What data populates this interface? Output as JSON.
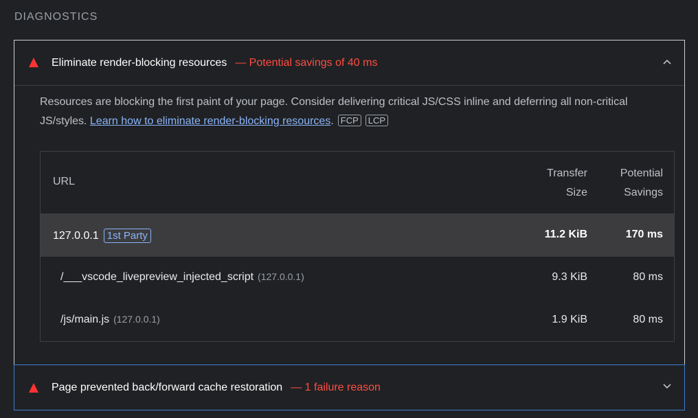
{
  "section_title": "DIAGNOSTICS",
  "audits": [
    {
      "title": "Eliminate render-blocking resources",
      "savings": "— Potential savings of 40 ms",
      "expanded": true,
      "description_text": "Resources are blocking the first paint of your page. Consider delivering critical JS/CSS inline and deferring all non-critical JS/styles. ",
      "link_text": "Learn how to eliminate render-blocking resources",
      "after_link": ".",
      "tags": [
        "FCP",
        "LCP"
      ],
      "table": {
        "headers": {
          "url": "URL",
          "transfer_line1": "Transfer",
          "transfer_line2": "Size",
          "savings_line1": "Potential",
          "savings_line2": "Savings"
        },
        "group": {
          "url": "127.0.0.1",
          "badge": "1st Party",
          "size": "11.2 KiB",
          "savings": "170 ms"
        },
        "rows": [
          {
            "url": "/___vscode_livepreview_injected_script",
            "origin": "(127.0.0.1)",
            "size": "9.3 KiB",
            "savings": "80 ms"
          },
          {
            "url": "/js/main.js",
            "origin": "(127.0.0.1)",
            "size": "1.9 KiB",
            "savings": "80 ms"
          }
        ]
      }
    },
    {
      "title": "Page prevented back/forward cache restoration",
      "savings": "— 1 failure reason",
      "expanded": false
    }
  ],
  "colors": {
    "fail": "#ff4e42",
    "link": "#8ab4f8",
    "background": "#202124"
  },
  "icons": {
    "fail": "warning-triangle-icon",
    "collapse": "chevron-up-icon",
    "expand": "chevron-down-icon"
  }
}
